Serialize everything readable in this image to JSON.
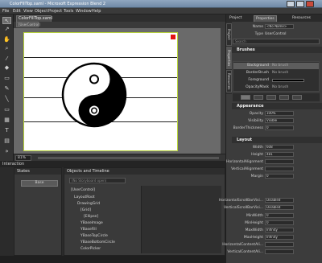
{
  "window": {
    "title": "ColorFillTop.xaml - Microsoft Expression Blend 2"
  },
  "menu": [
    "File",
    "Edit",
    "View",
    "Object",
    "Project",
    "Tools",
    "Window",
    "Help"
  ],
  "document": {
    "tab_label": "ColorFillTop.xaml",
    "breadcrumb": "[UserControl]",
    "zoom": "81%"
  },
  "interaction": {
    "title": "Interaction",
    "states_title": "States",
    "base_state": "Base",
    "objects_title": "Objects and Timeline",
    "search_placeholder": "(No Storyboard open)",
    "tree": [
      "[UserControl]",
      "LayoutRoot",
      "DrawingGrid",
      "[Grid]",
      "[Ellipse]",
      "YBaseImage",
      "YBaseFill",
      "YBaseTopCircle",
      "YBaseBottomCircle",
      "ColorPicker"
    ]
  },
  "right_panel": {
    "tabs": [
      "Project",
      "Properties",
      "Resources"
    ],
    "side_tabs": [
      "Project",
      "Properties",
      "Resources"
    ],
    "name_label": "Name",
    "name_value": "<No Name>",
    "type_label": "Type",
    "type_value": "UserControl",
    "search_placeholder": "Search",
    "brushes": {
      "title": "Brushes",
      "rows": [
        {
          "label": "Background",
          "value": "No brush"
        },
        {
          "label": "BorderBrush",
          "value": "No brush"
        },
        {
          "label": "Foreground",
          "value": ""
        },
        {
          "label": "OpacityMask",
          "value": "No brush"
        }
      ]
    },
    "appearance": {
      "title": "Appearance",
      "rows": [
        {
          "label": "Opacity",
          "value": "100%"
        },
        {
          "label": "Visibility",
          "value": "Visible"
        },
        {
          "label": "BorderThickness",
          "value": "0"
        }
      ]
    },
    "layout": {
      "title": "Layout",
      "rows": [
        {
          "label": "Width",
          "value": "608"
        },
        {
          "label": "Height",
          "value": "481"
        },
        {
          "label": "HorizontalAlignment",
          "value": ""
        },
        {
          "label": "VerticalAlignment",
          "value": ""
        },
        {
          "label": "Margin",
          "value": "0"
        },
        {
          "label": "HorizontalScrollBarVisi...",
          "value": "Disabled"
        },
        {
          "label": "VerticalScrollBarVisi...",
          "value": "Disabled"
        },
        {
          "label": "MinWidth",
          "value": "0"
        },
        {
          "label": "MinHeight",
          "value": "0"
        },
        {
          "label": "MaxWidth",
          "value": "Infinity"
        },
        {
          "label": "MaxHeight",
          "value": "Infinity"
        },
        {
          "label": "HorizontalContentAli...",
          "value": ""
        },
        {
          "label": "VerticalContentAli...",
          "value": ""
        }
      ]
    }
  }
}
